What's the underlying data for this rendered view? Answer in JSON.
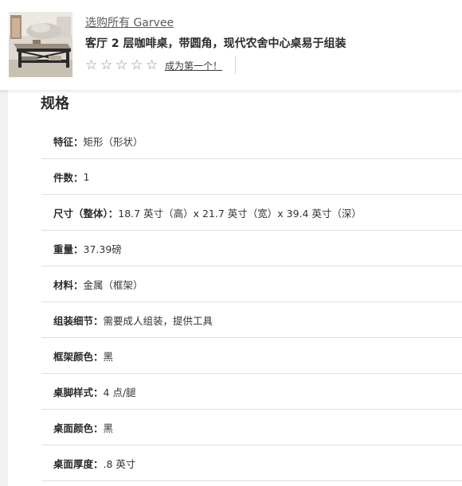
{
  "header": {
    "brand_link": "选购所有 Garvee",
    "title": "客厅 2 层咖啡桌，带圆角，现代农舍中心桌易于组装",
    "rating": {
      "value": 0,
      "max": 5,
      "star_glyph": "☆",
      "empty_text": "成为第一个！"
    },
    "thumbnail_icon": "coffee-table-photo"
  },
  "specs": {
    "heading": "规格",
    "rows": [
      {
        "label": "特征：",
        "value": "矩形（形状）"
      },
      {
        "label": "件数：",
        "value": "1"
      },
      {
        "label": "尺寸（整体）：",
        "value": "18.7 英寸（高）x 21.7 英寸（宽）x 39.4 英寸（深）"
      },
      {
        "label": "重量：",
        "value": "37.39磅"
      },
      {
        "label": "材料：",
        "value": "金属（框架）"
      },
      {
        "label": "组装细节：",
        "value": "需要成人组装，提供工具"
      },
      {
        "label": "框架颜色：",
        "value": "黑"
      },
      {
        "label": "桌脚样式：",
        "value": "4 点/腿"
      },
      {
        "label": "桌面颜色：",
        "value": "黑"
      },
      {
        "label": "桌面厚度：",
        "value": ".8 英寸"
      }
    ]
  }
}
